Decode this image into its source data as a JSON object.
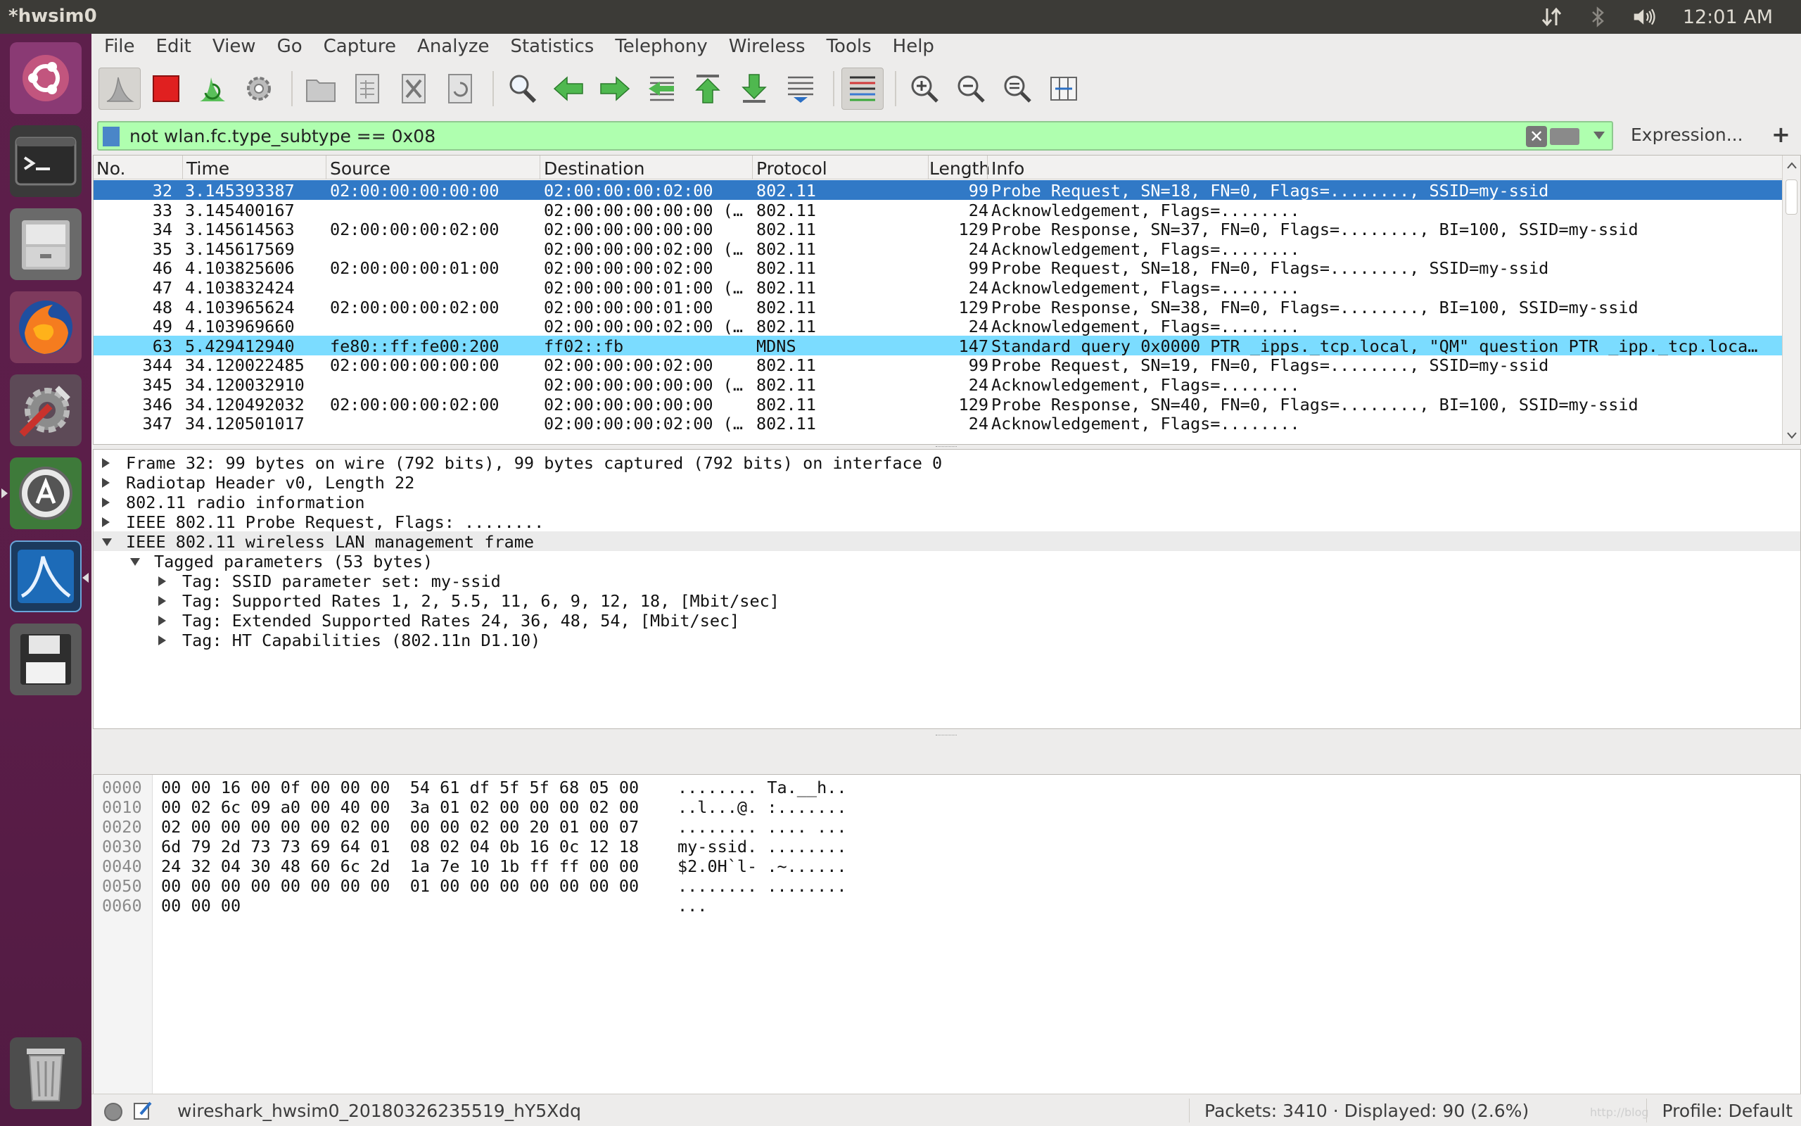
{
  "topbar": {
    "title": "*hwsim0",
    "clock": "12:01 AM",
    "icons": [
      "network-arrows-icon",
      "bluetooth-icon",
      "volume-icon"
    ]
  },
  "launcher": {
    "apps": [
      "ubuntu-dash",
      "terminal",
      "file-manager",
      "firefox",
      "system-settings",
      "software-updater",
      "wireshark",
      "save-disk"
    ],
    "trash": "trash"
  },
  "menubar": {
    "items": [
      "File",
      "Edit",
      "View",
      "Go",
      "Capture",
      "Analyze",
      "Statistics",
      "Telephony",
      "Wireless",
      "Tools",
      "Help"
    ]
  },
  "filter": {
    "value": "not wlan.fc.type_subtype == 0x08",
    "expression_label": "Expression...",
    "add_label": "+"
  },
  "packet_list": {
    "columns": [
      "No.",
      "Time",
      "Source",
      "Destination",
      "Protocol",
      "Length",
      "Info"
    ],
    "rows": [
      {
        "no": "32",
        "time": "3.145393387",
        "src": "02:00:00:00:00:00",
        "dst": "02:00:00:00:02:00",
        "proto": "802.11",
        "len": "99",
        "info": "Probe Request, SN=18, FN=0, Flags=........, SSID=my-ssid"
      },
      {
        "no": "33",
        "time": "3.145400167",
        "src": "",
        "dst": "02:00:00:00:00:00 (…",
        "proto": "802.11",
        "len": "24",
        "info": "Acknowledgement, Flags=........"
      },
      {
        "no": "34",
        "time": "3.145614563",
        "src": "02:00:00:00:02:00",
        "dst": "02:00:00:00:00:00",
        "proto": "802.11",
        "len": "129",
        "info": "Probe Response, SN=37, FN=0, Flags=........, BI=100, SSID=my-ssid"
      },
      {
        "no": "35",
        "time": "3.145617569",
        "src": "",
        "dst": "02:00:00:00:02:00 (…",
        "proto": "802.11",
        "len": "24",
        "info": "Acknowledgement, Flags=........"
      },
      {
        "no": "46",
        "time": "4.103825606",
        "src": "02:00:00:00:01:00",
        "dst": "02:00:00:00:02:00",
        "proto": "802.11",
        "len": "99",
        "info": "Probe Request, SN=18, FN=0, Flags=........, SSID=my-ssid"
      },
      {
        "no": "47",
        "time": "4.103832424",
        "src": "",
        "dst": "02:00:00:00:01:00 (…",
        "proto": "802.11",
        "len": "24",
        "info": "Acknowledgement, Flags=........"
      },
      {
        "no": "48",
        "time": "4.103965624",
        "src": "02:00:00:00:02:00",
        "dst": "02:00:00:00:01:00",
        "proto": "802.11",
        "len": "129",
        "info": "Probe Response, SN=38, FN=0, Flags=........, BI=100, SSID=my-ssid"
      },
      {
        "no": "49",
        "time": "4.103969660",
        "src": "",
        "dst": "02:00:00:00:02:00 (…",
        "proto": "802.11",
        "len": "24",
        "info": "Acknowledgement, Flags=........"
      },
      {
        "no": "63",
        "time": "5.429412940",
        "src": "fe80::ff:fe00:200",
        "dst": "ff02::fb",
        "proto": "MDNS",
        "len": "147",
        "info": "Standard query 0x0000 PTR _ipps._tcp.local, \"QM\" question PTR _ipp._tcp.loca…"
      },
      {
        "no": "344",
        "time": "34.120022485",
        "src": "02:00:00:00:00:00",
        "dst": "02:00:00:00:02:00",
        "proto": "802.11",
        "len": "99",
        "info": "Probe Request, SN=19, FN=0, Flags=........, SSID=my-ssid"
      },
      {
        "no": "345",
        "time": "34.120032910",
        "src": "",
        "dst": "02:00:00:00:00:00 (…",
        "proto": "802.11",
        "len": "24",
        "info": "Acknowledgement, Flags=........"
      },
      {
        "no": "346",
        "time": "34.120492032",
        "src": "02:00:00:00:02:00",
        "dst": "02:00:00:00:00:00",
        "proto": "802.11",
        "len": "129",
        "info": "Probe Response, SN=40, FN=0, Flags=........, BI=100, SSID=my-ssid"
      },
      {
        "no": "347",
        "time": "34.120501017",
        "src": "",
        "dst": "02:00:00:00:02:00 (…",
        "proto": "802.11",
        "len": "24",
        "info": "Acknowledgement, Flags=........"
      }
    ]
  },
  "details": {
    "rows": [
      {
        "text": "Frame 32: 99 bytes on wire (792 bits), 99 bytes captured (792 bits) on interface 0",
        "state": "collapsed",
        "level": 0
      },
      {
        "text": "Radiotap Header v0, Length 22",
        "state": "collapsed",
        "level": 0
      },
      {
        "text": "802.11 radio information",
        "state": "collapsed",
        "level": 0
      },
      {
        "text": "IEEE 802.11 Probe Request, Flags: ........",
        "state": "collapsed",
        "level": 0
      },
      {
        "text": "IEEE 802.11 wireless LAN management frame",
        "state": "expanded",
        "level": 0
      },
      {
        "text": "Tagged parameters (53 bytes)",
        "state": "expanded",
        "level": 1
      },
      {
        "text": "Tag: SSID parameter set: my-ssid",
        "state": "collapsed",
        "level": 2
      },
      {
        "text": "Tag: Supported Rates 1, 2, 5.5, 11, 6, 9, 12, 18, [Mbit/sec]",
        "state": "collapsed",
        "level": 2
      },
      {
        "text": "Tag: Extended Supported Rates 24, 36, 48, 54, [Mbit/sec]",
        "state": "collapsed",
        "level": 2
      },
      {
        "text": "Tag: HT Capabilities (802.11n D1.10)",
        "state": "collapsed",
        "level": 2
      }
    ]
  },
  "bytes": {
    "rows": [
      {
        "off": "0000",
        "hex": "00 00 16 00 0f 00 00 00  54 61 df 5f 5f 68 05 00",
        "ascii": "........ Ta.__h.."
      },
      {
        "off": "0010",
        "hex": "00 02 6c 09 a0 00 40 00  3a 01 02 00 00 00 02 00",
        "ascii": "..l...@. :......."
      },
      {
        "off": "0020",
        "hex": "02 00 00 00 00 00 02 00  00 00 02 00 20 01 00 07",
        "ascii": "........ .... ..."
      },
      {
        "off": "0030",
        "hex": "6d 79 2d 73 73 69 64 01  08 02 04 0b 16 0c 12 18",
        "ascii": "my-ssid. ........"
      },
      {
        "off": "0040",
        "hex": "24 32 04 30 48 60 6c 2d  1a 7e 10 1b ff ff 00 00",
        "ascii": "$2.0H`l- .~......"
      },
      {
        "off": "0050",
        "hex": "00 00 00 00 00 00 00 00  01 00 00 00 00 00 00 00",
        "ascii": "........ ........"
      },
      {
        "off": "0060",
        "hex": "00 00 00",
        "ascii": "..."
      }
    ]
  },
  "status": {
    "file": "wireshark_hwsim0_20180326235519_hY5Xdq",
    "packets": "Packets: 3410 · Displayed: 90 (2.6%)",
    "profile": "Profile: Default",
    "watermark": "http://blog"
  },
  "colors": {
    "selected_row": "#3179c6",
    "mdns_row": "#7bdcff",
    "filter_valid": "#afffaf",
    "launcher_bg": "#5d1f4b",
    "topbar_bg": "#3c3b37"
  }
}
